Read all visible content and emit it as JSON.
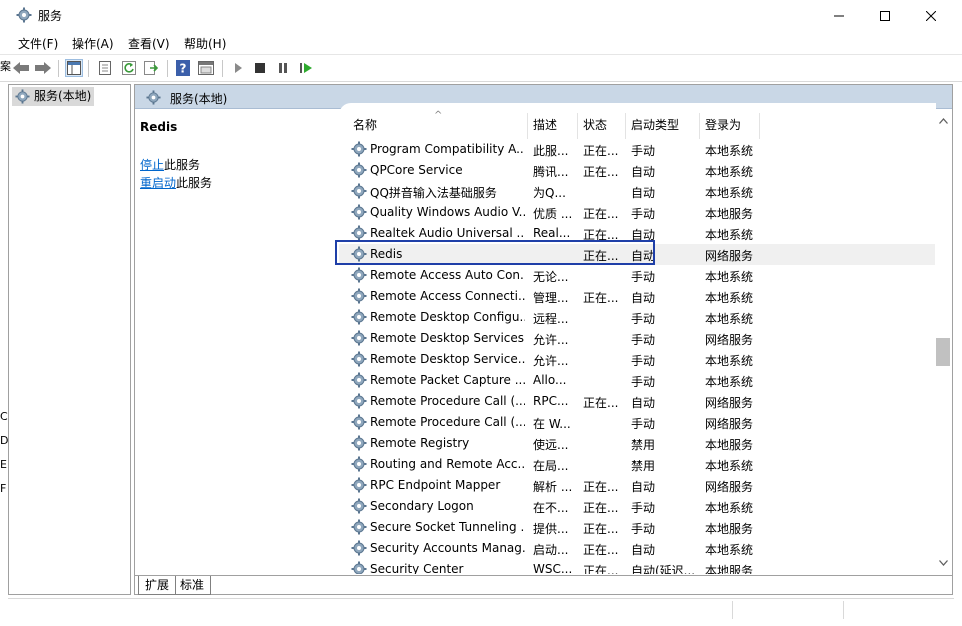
{
  "window": {
    "title": "服务"
  },
  "menu": [
    {
      "label": "文件(F)"
    },
    {
      "label": "操作(A)"
    },
    {
      "label": "查看(V)"
    },
    {
      "label": "帮助(H)"
    }
  ],
  "tree": {
    "root_label": "服务(本地)"
  },
  "panel": {
    "header": "服务(本地)",
    "selected_service": "Redis",
    "actions": [
      {
        "link": "停止",
        "suffix": "此服务"
      },
      {
        "link": "重启动",
        "suffix": "此服务"
      }
    ]
  },
  "columns": [
    "名称",
    "描述",
    "状态",
    "启动类型",
    "登录为"
  ],
  "services": [
    {
      "name": "Program Compatibility A...",
      "desc": "此服...",
      "status": "正在...",
      "startup": "手动",
      "logon": "本地系统"
    },
    {
      "name": "QPCore Service",
      "desc": "腾讯...",
      "status": "正在...",
      "startup": "自动",
      "logon": "本地系统"
    },
    {
      "name": "QQ拼音输入法基础服务",
      "desc": "为Q...",
      "status": "",
      "startup": "自动",
      "logon": "本地系统"
    },
    {
      "name": "Quality Windows Audio V...",
      "desc": "优质 ...",
      "status": "正在...",
      "startup": "手动",
      "logon": "本地服务"
    },
    {
      "name": "Realtek Audio Universal ...",
      "desc": "Real...",
      "status": "正在...",
      "startup": "自动",
      "logon": "本地系统"
    },
    {
      "name": "Redis",
      "desc": "",
      "status": "正在...",
      "startup": "自动",
      "logon": "网络服务",
      "selected": true
    },
    {
      "name": "Remote Access Auto Con...",
      "desc": "无论...",
      "status": "",
      "startup": "手动",
      "logon": "本地系统"
    },
    {
      "name": "Remote Access Connecti...",
      "desc": "管理...",
      "status": "正在...",
      "startup": "自动",
      "logon": "本地系统"
    },
    {
      "name": "Remote Desktop Configu...",
      "desc": "远程...",
      "status": "",
      "startup": "手动",
      "logon": "本地系统"
    },
    {
      "name": "Remote Desktop Services",
      "desc": "允许...",
      "status": "",
      "startup": "手动",
      "logon": "网络服务"
    },
    {
      "name": "Remote Desktop Service...",
      "desc": "允许...",
      "status": "",
      "startup": "手动",
      "logon": "本地系统"
    },
    {
      "name": "Remote Packet Capture ...",
      "desc": "Allo...",
      "status": "",
      "startup": "手动",
      "logon": "本地系统"
    },
    {
      "name": "Remote Procedure Call (...",
      "desc": "RPC...",
      "status": "正在...",
      "startup": "自动",
      "logon": "网络服务"
    },
    {
      "name": "Remote Procedure Call (...",
      "desc": "在 W...",
      "status": "",
      "startup": "手动",
      "logon": "网络服务"
    },
    {
      "name": "Remote Registry",
      "desc": "使远...",
      "status": "",
      "startup": "禁用",
      "logon": "本地服务"
    },
    {
      "name": "Routing and Remote Acc...",
      "desc": "在局...",
      "status": "",
      "startup": "禁用",
      "logon": "本地系统"
    },
    {
      "name": "RPC Endpoint Mapper",
      "desc": "解析 ...",
      "status": "正在...",
      "startup": "自动",
      "logon": "网络服务"
    },
    {
      "name": "Secondary Logon",
      "desc": "在不...",
      "status": "正在...",
      "startup": "手动",
      "logon": "本地系统"
    },
    {
      "name": "Secure Socket Tunneling ...",
      "desc": "提供...",
      "status": "正在...",
      "startup": "手动",
      "logon": "本地服务"
    },
    {
      "name": "Security Accounts Manag...",
      "desc": "启动...",
      "status": "正在...",
      "startup": "自动",
      "logon": "本地系统"
    },
    {
      "name": "Security Center",
      "desc": "WSC...",
      "status": "正在...",
      "startup": "自动(延迟...",
      "logon": "本地服务"
    }
  ],
  "tabs": [
    {
      "label": "扩展"
    },
    {
      "label": "标准"
    }
  ],
  "edge_fragments": [
    "案",
    "C",
    "D",
    "E",
    "F"
  ],
  "colors": {
    "panel_header_bg": "#c9d7e6",
    "highlight_border": "#1f3fa8",
    "link": "#0066cc"
  }
}
